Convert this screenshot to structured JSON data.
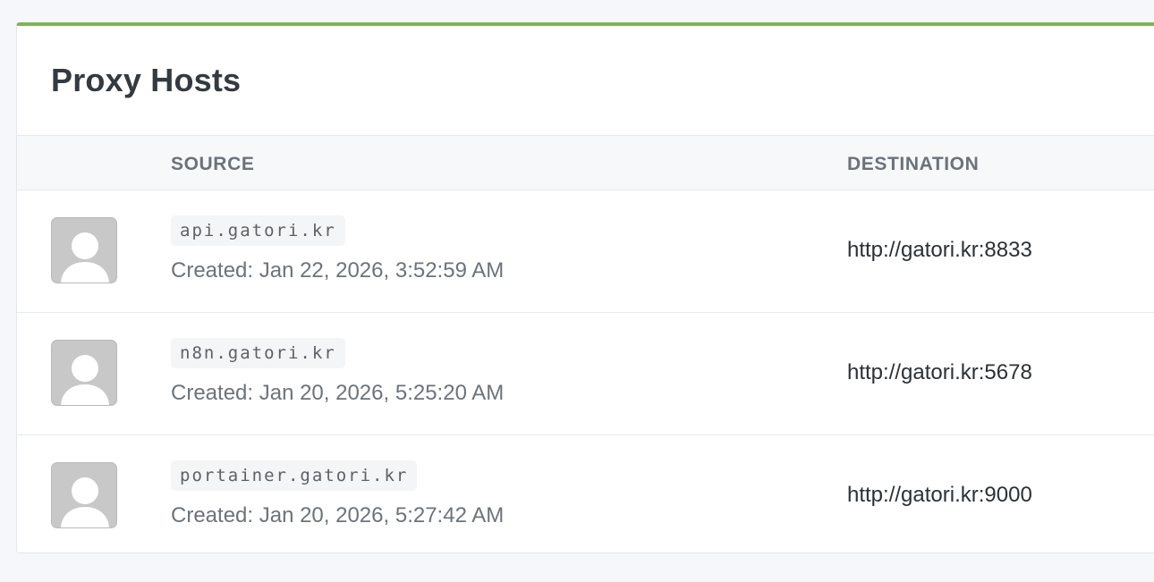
{
  "page": {
    "title": "Proxy Hosts",
    "accent_color": "#7bb84a"
  },
  "table": {
    "columns": {
      "source": "SOURCE",
      "destination": "DESTINATION"
    },
    "rows": [
      {
        "avatar_icon": "default-user-avatar-icon",
        "domain": "api.gatori.kr",
        "created": "Created: Jan 22, 2026, 3:52:59 AM",
        "destination": "http://gatori.kr:8833"
      },
      {
        "avatar_icon": "default-user-avatar-icon",
        "domain": "n8n.gatori.kr",
        "created": "Created: Jan 20, 2026, 5:25:20 AM",
        "destination": "http://gatori.kr:5678"
      },
      {
        "avatar_icon": "default-user-avatar-icon",
        "domain": "portainer.gatori.kr",
        "created": "Created: Jan 20, 2026, 5:27:42 AM",
        "destination": "http://gatori.kr:9000"
      }
    ]
  }
}
